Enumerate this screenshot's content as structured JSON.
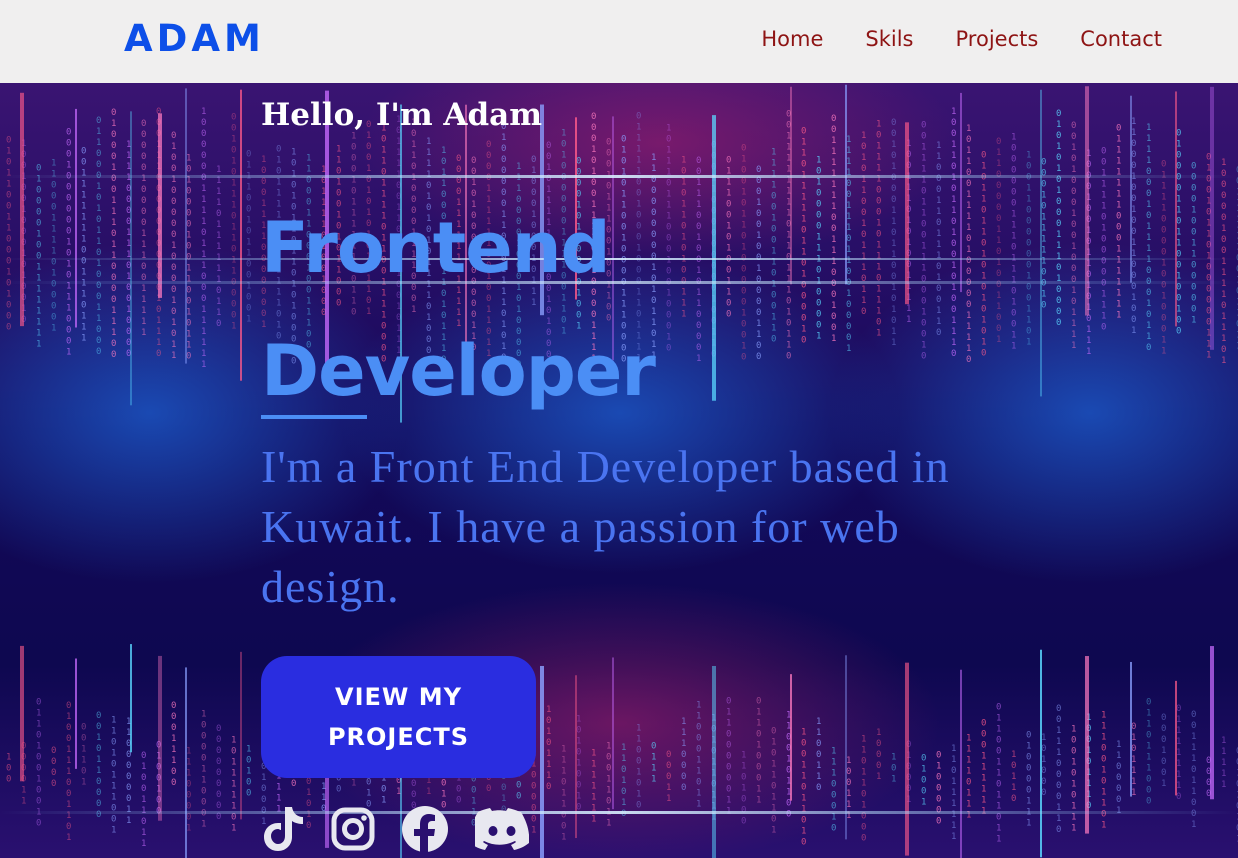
{
  "nav": {
    "logo": "ADAM",
    "links": [
      "Home",
      "Skils",
      "Projects",
      "Contact"
    ]
  },
  "hero": {
    "greeting": "Hello, I'm Adam",
    "headline_line1": "Frontend",
    "headline_line2": "Developer",
    "intro": "I'm a Front End Developer based in Kuwait. I have a passion for web design.",
    "cta_line1": "VIEW MY",
    "cta_line2": "PROJECTS"
  },
  "socials": [
    "tiktok-icon",
    "instagram-icon",
    "facebook-icon",
    "discord-icon"
  ],
  "colors": {
    "logo": "#0d4fe8",
    "nav_link": "#8e1414",
    "navbar_bg": "#f0efef",
    "headline": "#4b8ef5",
    "intro": "#4a74f0",
    "cta_bg": "#2a2de0"
  }
}
